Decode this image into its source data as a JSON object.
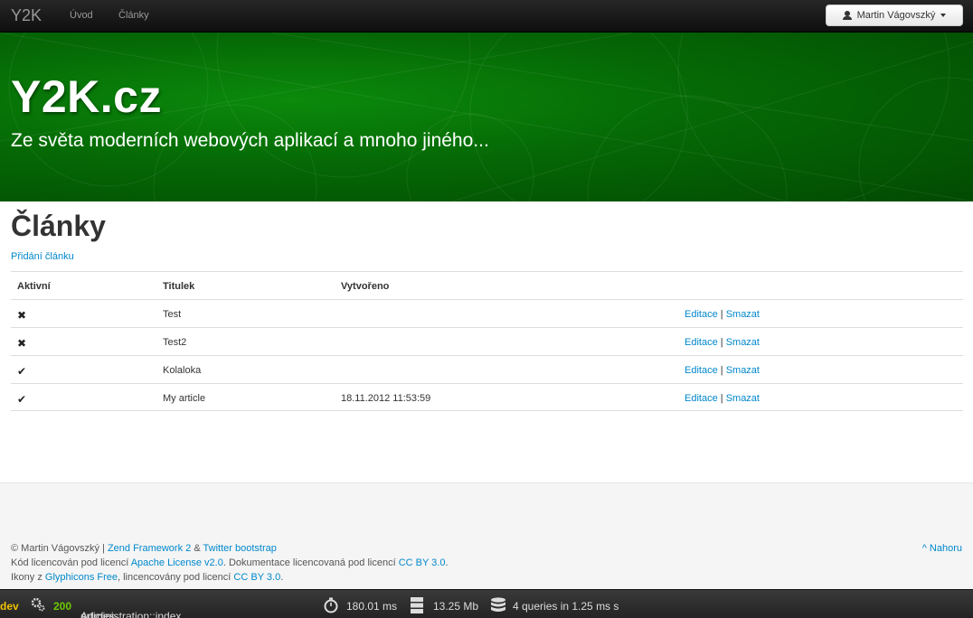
{
  "navbar": {
    "brand": "Y2K",
    "links": [
      "Úvod",
      "Články"
    ],
    "user": "Martin Vágovszký"
  },
  "hero": {
    "title": "Y2K.cz",
    "subtitle": "Ze světa moderních webových aplikací a mnoho jiného..."
  },
  "main": {
    "title": "Články",
    "add_link": "Přidání článku",
    "columns": [
      "Aktivní",
      "Titulek",
      "Vytvořeno"
    ],
    "rows": [
      {
        "active": "✖",
        "title": "Test",
        "created": "",
        "edit": "Editace",
        "sep": "|",
        "delete": "Smazat"
      },
      {
        "active": "✖",
        "title": "Test2",
        "created": "",
        "edit": "Editace",
        "sep": "|",
        "delete": "Smazat"
      },
      {
        "active": "✔",
        "title": "Kolaloka",
        "created": "",
        "edit": "Editace",
        "sep": "|",
        "delete": "Smazat"
      },
      {
        "active": "✔",
        "title": "My article",
        "created": "18.11.2012 11:53:59",
        "edit": "Editace",
        "sep": "|",
        "delete": "Smazat"
      }
    ]
  },
  "footer": {
    "line1": {
      "prefix": "© Martin Vágovszký | ",
      "link1": "Zend Framework 2",
      "amp": " & ",
      "link2": "Twitter bootstrap"
    },
    "line2": {
      "prefix": "Kód licencován pod licencí ",
      "link1": "Apache License v2.0",
      "middle": ". Dokumentace licencovaná pod licencí ",
      "link2": "CC BY 3.0",
      "suffix": "."
    },
    "line3": {
      "prefix": "Ikony z ",
      "link1": "Glyphicons Free",
      "middle": ", lincencovány pod licencí ",
      "link2": "CC BY 3.0",
      "suffix": "."
    },
    "top_link": "^ Nahoru"
  },
  "devbar": {
    "env": "dev",
    "status": "200",
    "route": "Administration::index",
    "on": "on",
    "route_name": "articles-administration",
    "time": "180.01 ms",
    "memory": "13.25 Mb",
    "queries": "4 queries in 1.25 ms s"
  },
  "colors": {
    "accent": "#0088cc",
    "hero_green": "#056805",
    "navbar": "#1b1b1b",
    "status_ok": "#6ec800",
    "env": "#f0c000"
  }
}
